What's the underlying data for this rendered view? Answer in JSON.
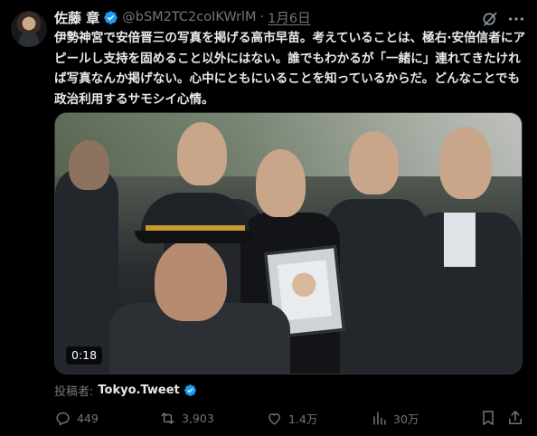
{
  "tweet": {
    "author_name": "佐藤 章",
    "handle": "@bSM2TC2coIKWrlM",
    "separator": "·",
    "date": "1月6日",
    "text": "伊勢神宮で安倍晋三の写真を掲げる高市早苗。考えていることは、極右·安倍信者にアピールし支持を固めること以外にはない。誰でもわかるが「一緒に」連れてきたければ写真なんか掲げない。心中にともにいることを知っているからだ。どんなことでも政治利用するサモシイ心情。",
    "video_duration": "0:18",
    "poster_label": "投稿者:",
    "poster_account": "Tokyo.Tweet",
    "accent_color": "#1d9bf0"
  },
  "actions": {
    "replies": "449",
    "reposts": "3,903",
    "likes": "1.4万",
    "views": "30万"
  },
  "icons": [
    "verified-badge-icon",
    "grok-icon",
    "more-icon",
    "reply-icon",
    "repost-icon",
    "like-icon",
    "views-icon",
    "bookmark-icon",
    "share-icon"
  ]
}
